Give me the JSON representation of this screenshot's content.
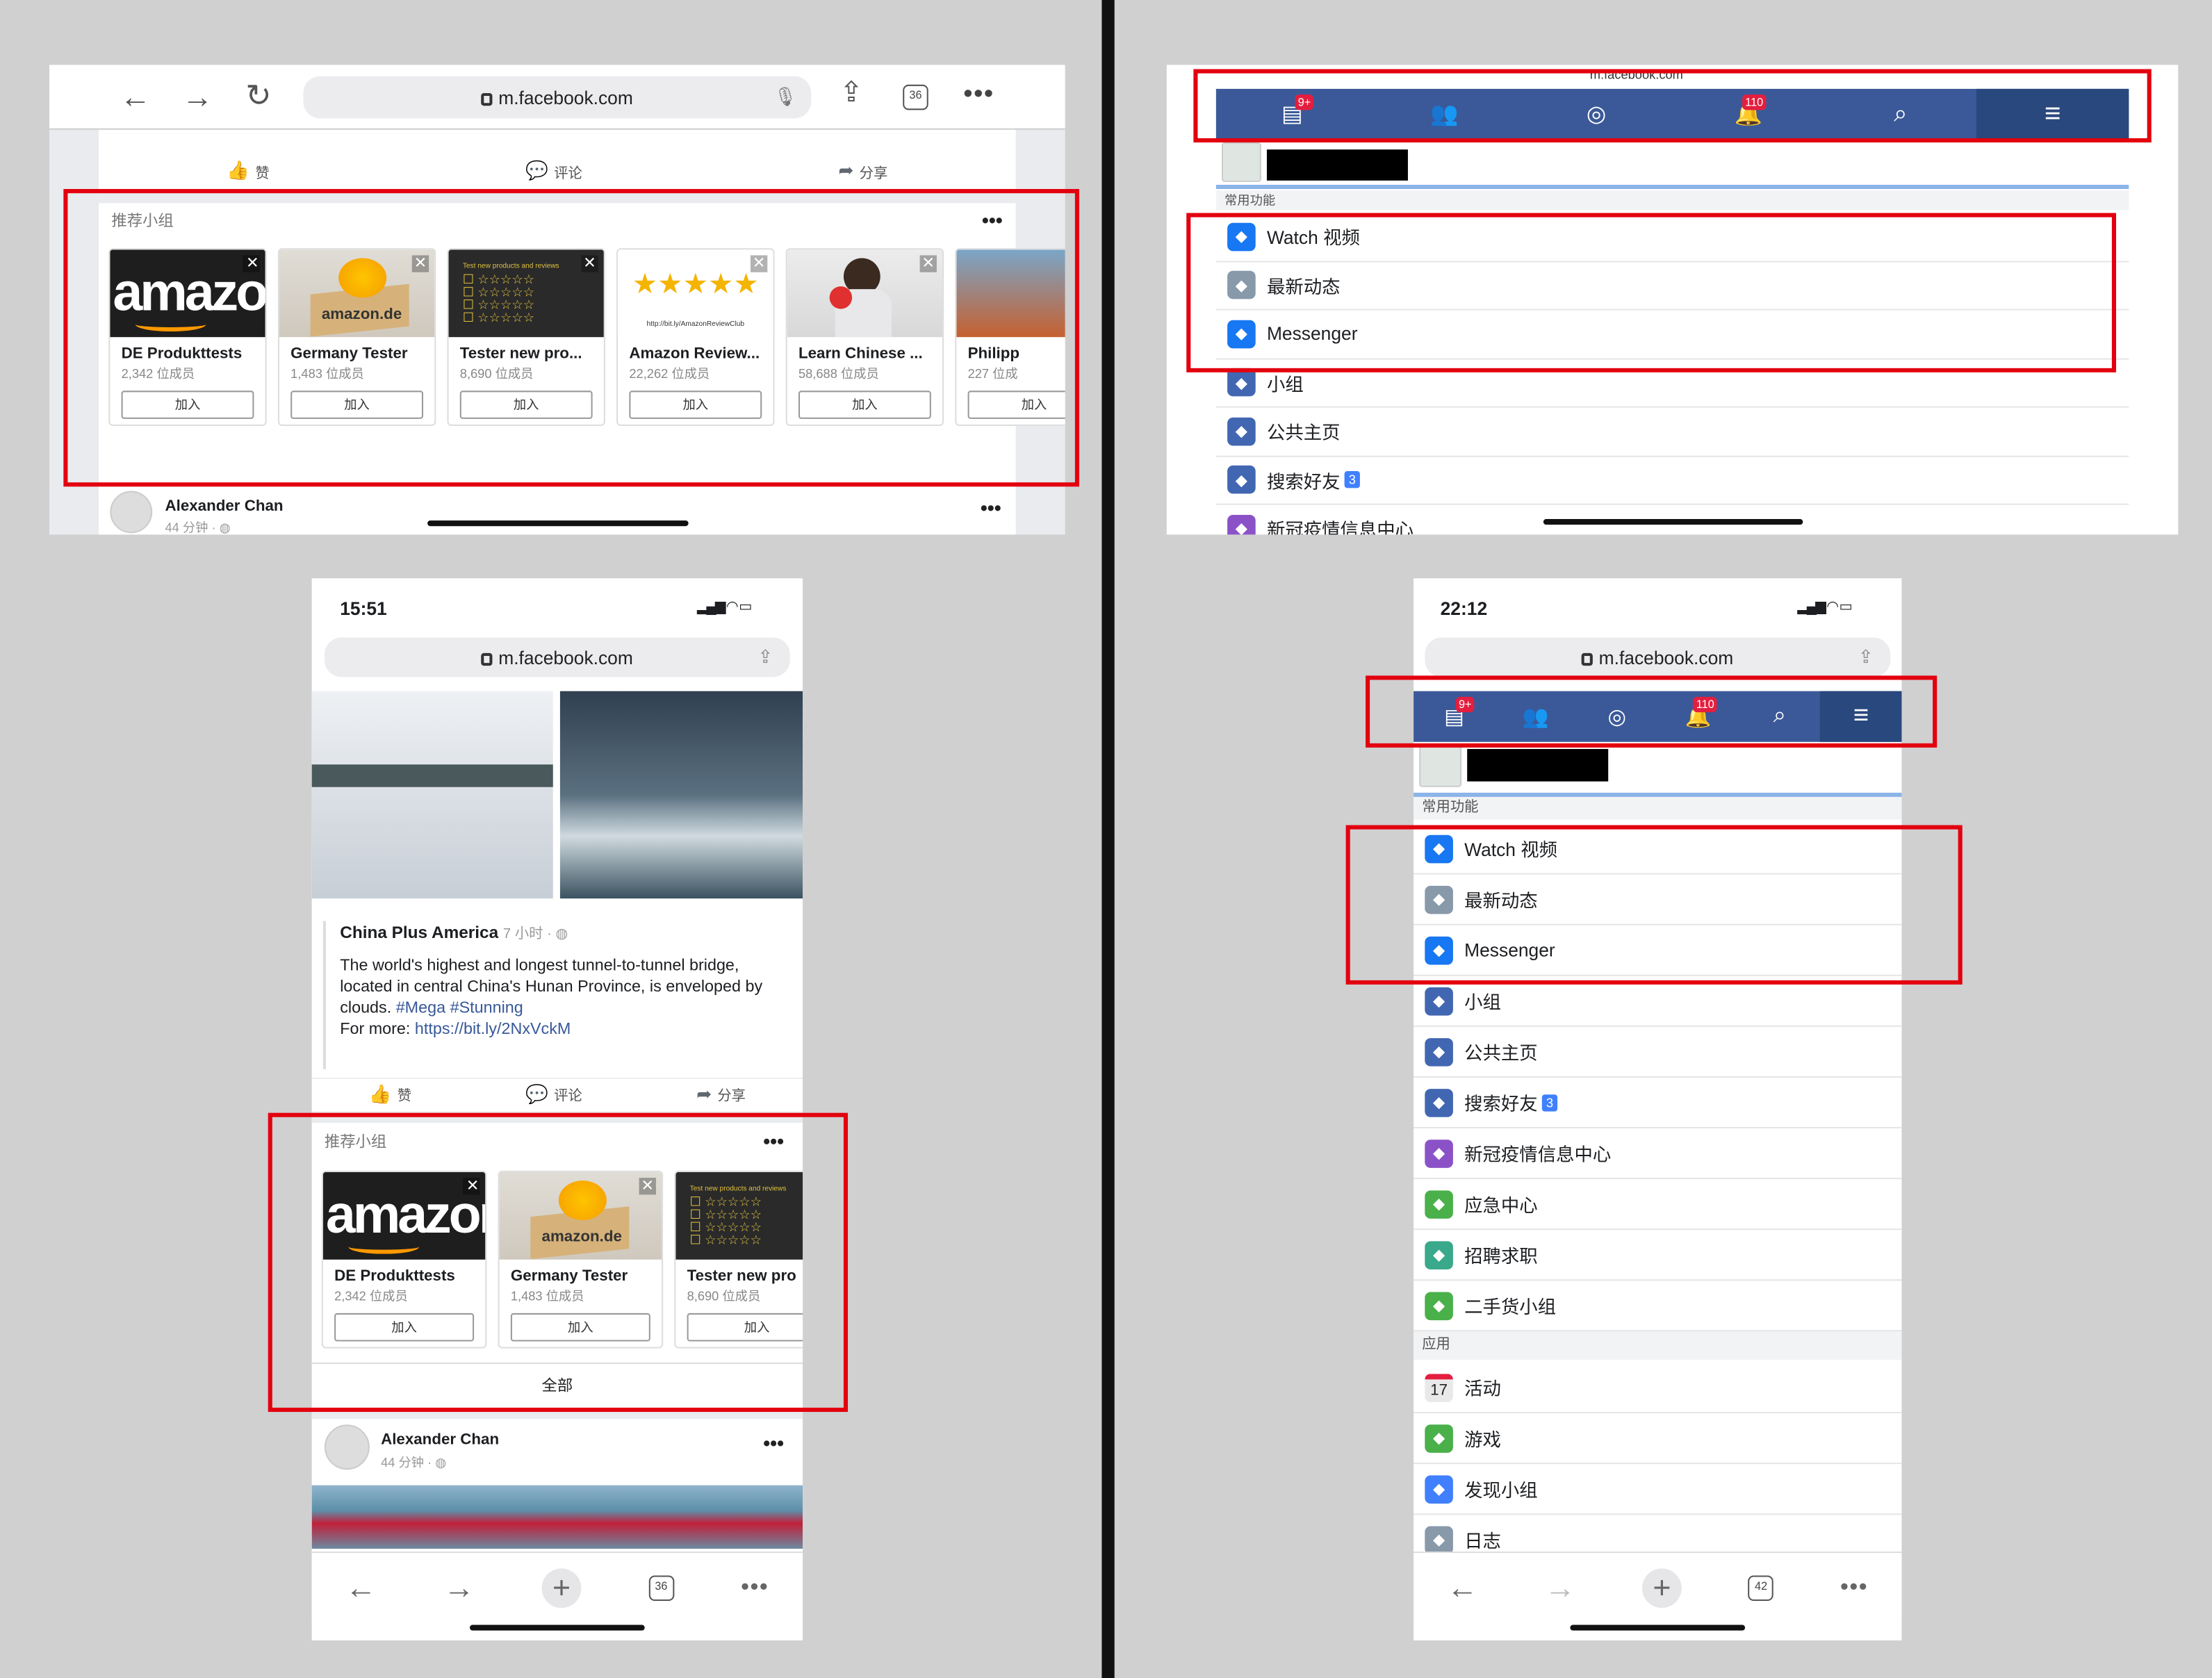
{
  "url": "m.facebook.com",
  "url_short": "m.facebook.com",
  "feed": {
    "actions": {
      "like": "赞",
      "comment": "评论",
      "share": "分享"
    },
    "groups_title": "推荐小组",
    "groups": [
      {
        "name": "DE Produkttests",
        "members": "2,342 位成员",
        "join": "加入"
      },
      {
        "name": "Germany Tester",
        "members": "1,483 位成员",
        "join": "加入"
      },
      {
        "name": "Tester new pro...",
        "members": "8,690 位成员",
        "join": "加入"
      },
      {
        "name": "Amazon Review...",
        "members": "22,262 位成员",
        "join": "加入"
      },
      {
        "name": "Learn Chinese ...",
        "members": "58,688 位成员",
        "join": "加入"
      },
      {
        "name": "Philipp",
        "members": "227 位成",
        "join": "加入"
      }
    ],
    "groups_phone_names": [
      "DE Produkttests",
      "Germany Tester",
      "Tester new pro"
    ],
    "all": "全部",
    "next_post": {
      "author": "Alexander Chan",
      "time": "44 分钟 · ◍"
    },
    "post": {
      "author": "China Plus America",
      "time": "7 小时 · ◍",
      "text1": "The world's highest and longest tunnel-to-tunnel bridge, located in central China's Hunan Province, is enveloped by clouds.",
      "tag1": "#Mega",
      "tag2": "#Stunning",
      "more": "For more:",
      "link": "https://bit.ly/2NxVckM"
    },
    "img_text": {
      "amazon": "amazon",
      "amazon_de": "amazon.de",
      "review_stars": "★★★★★",
      "review_url": "http://bit.ly/AmazonReviewClub",
      "stars_caption": "Test new products and reviews"
    },
    "tab_count": "36",
    "status_time": "15:51"
  },
  "menu": {
    "status_time": "22:12",
    "tab_count": "42",
    "nav_badges": {
      "home": "9+",
      "notif": "110"
    },
    "section_common": "常用功能",
    "items": [
      {
        "label": "Watch 视频",
        "icon": "watch-icon",
        "color": "#1877f2"
      },
      {
        "label": "最新动态",
        "icon": "news-feed-icon",
        "color": "#8899aa"
      },
      {
        "label": "Messenger",
        "icon": "messenger-icon",
        "color": "#1877f2"
      },
      {
        "label": "小组",
        "icon": "groups-icon",
        "color": "#4267b2"
      },
      {
        "label": "公共主页",
        "icon": "pages-icon",
        "color": "#4267b2"
      },
      {
        "label": "搜索好友",
        "icon": "find-friends-icon",
        "color": "#4267b2",
        "count": "3"
      },
      {
        "label": "新冠疫情信息中心",
        "icon": "covid-center-icon",
        "color": "#8b52c8"
      },
      {
        "label": "应急中心",
        "icon": "crisis-response-icon",
        "color": "#4ab04a"
      },
      {
        "label": "招聘求职",
        "icon": "jobs-icon",
        "color": "#3aa88a"
      },
      {
        "label": "二手货小组",
        "icon": "buy-sell-icon",
        "color": "#4ab04a"
      }
    ],
    "section_apps": "应用",
    "apps": [
      {
        "label": "活动",
        "icon": "events-icon",
        "color": "#e9e9e9",
        "num": "17"
      },
      {
        "label": "游戏",
        "icon": "games-icon",
        "color": "#4ab04a"
      },
      {
        "label": "发现小组",
        "icon": "discover-groups-icon",
        "color": "#4080ff"
      },
      {
        "label": "日志",
        "icon": "notes-icon",
        "color": "#8899aa"
      }
    ],
    "ipad_partial": "新冠疫情信息中心"
  }
}
